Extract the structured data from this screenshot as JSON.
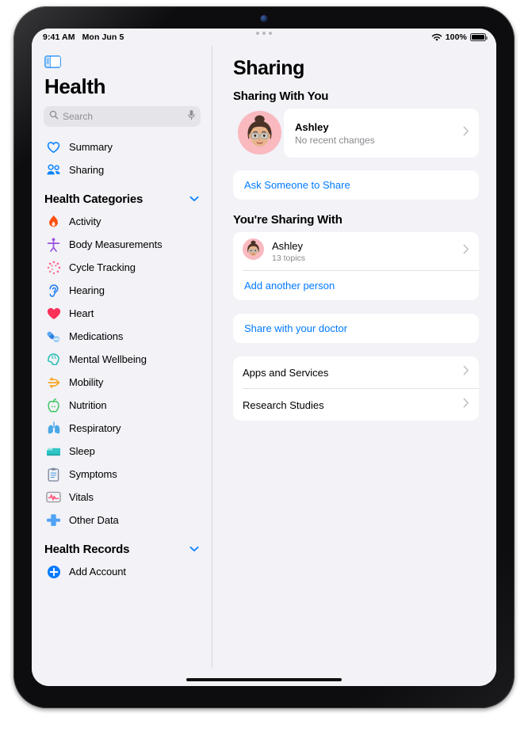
{
  "status_bar": {
    "time": "9:41 AM",
    "date": "Mon Jun 5",
    "wifi_icon": "wifi-icon",
    "battery_percent": "100%",
    "battery_icon": "battery-full-icon",
    "multitask_icon": "multitasking-dots-icon"
  },
  "sidebar": {
    "toggle_icon": "sidebar-toggle-icon",
    "app_title": "Health",
    "search": {
      "placeholder": "Search",
      "value": "",
      "search_icon": "search-icon",
      "dictation_icon": "microphone-icon"
    },
    "primary_items": [
      {
        "label": "Summary",
        "icon": "heart-outline-icon",
        "color": "#0a84ff"
      },
      {
        "label": "Sharing",
        "icon": "two-people-icon",
        "color": "#0a84ff"
      }
    ],
    "sections": [
      {
        "title": "Health Categories",
        "chevron_icon": "chevron-down-icon",
        "items": [
          {
            "label": "Activity",
            "icon": "flame-icon",
            "color": "#ff4f0f"
          },
          {
            "label": "Body Measurements",
            "icon": "body-figure-icon",
            "color": "#9b51e0"
          },
          {
            "label": "Cycle Tracking",
            "icon": "cycle-burst-icon",
            "color": "#ff5a7a"
          },
          {
            "label": "Hearing",
            "icon": "ear-icon",
            "color": "#1f7cf2"
          },
          {
            "label": "Heart",
            "icon": "heart-filled-icon",
            "color": "#fc3158"
          },
          {
            "label": "Medications",
            "icon": "pills-icon",
            "color": "#2f7fe0"
          },
          {
            "label": "Mental Wellbeing",
            "icon": "head-brain-icon",
            "color": "#18b8b0"
          },
          {
            "label": "Mobility",
            "icon": "arrows-motion-icon",
            "color": "#f5a623"
          },
          {
            "label": "Nutrition",
            "icon": "apple-icon",
            "color": "#34c759"
          },
          {
            "label": "Respiratory",
            "icon": "lungs-icon",
            "color": "#4aa8e8"
          },
          {
            "label": "Sleep",
            "icon": "bed-icon",
            "color": "#2bc4c4"
          },
          {
            "label": "Symptoms",
            "icon": "clipboard-icon",
            "color": "#7f8a9e"
          },
          {
            "label": "Vitals",
            "icon": "waveform-monitor-icon",
            "color": "#ff4a6e"
          },
          {
            "label": "Other Data",
            "icon": "plus-cross-icon",
            "color": "#51a2f5"
          }
        ]
      },
      {
        "title": "Health Records",
        "chevron_icon": "chevron-down-icon",
        "items": [
          {
            "label": "Add Account",
            "icon": "plus-circle-icon",
            "color": "#007aff"
          }
        ]
      }
    ]
  },
  "detail": {
    "title": "Sharing",
    "sharing_with_you": {
      "header": "Sharing With You",
      "person": {
        "name": "Ashley",
        "status": "No recent changes",
        "avatar_icon": "memoji-avatar",
        "chevron_icon": "chevron-right-icon"
      },
      "ask_link": "Ask Someone to Share"
    },
    "youre_sharing_with": {
      "header": "You're Sharing With",
      "person": {
        "name": "Ashley",
        "subtitle": "13 topics",
        "avatar_icon": "memoji-avatar",
        "chevron_icon": "chevron-right-icon"
      },
      "add_link": "Add another person"
    },
    "doctor_link": "Share with your doctor",
    "extra_rows": [
      {
        "label": "Apps and Services",
        "chevron_icon": "chevron-right-icon"
      },
      {
        "label": "Research Studies",
        "chevron_icon": "chevron-right-icon"
      }
    ]
  },
  "colors": {
    "accent": "#007aff",
    "background": "#f2f2f7",
    "card": "#ffffff",
    "secondary_text": "#8a8a8f",
    "avatar_bg": "#f8b7bc"
  },
  "home_indicator": "home-indicator"
}
